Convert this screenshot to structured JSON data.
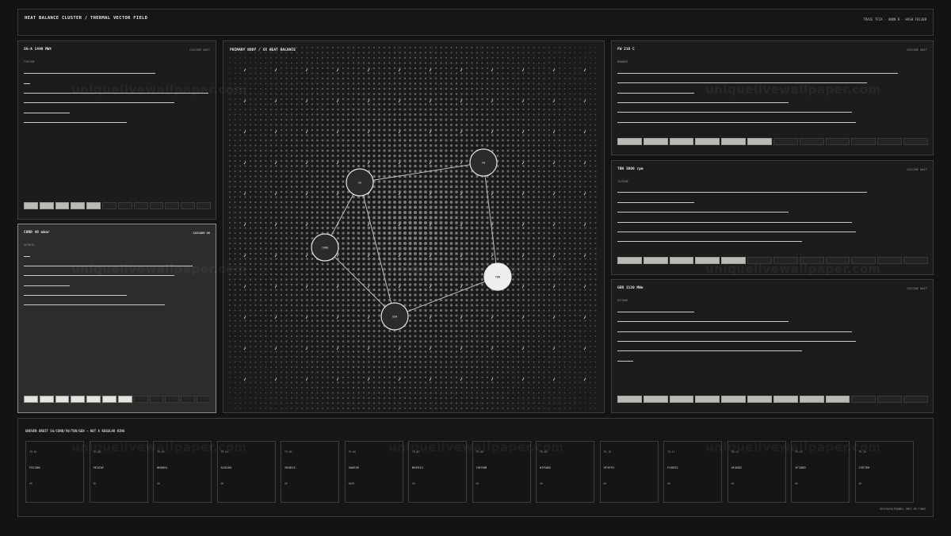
{
  "header": {
    "title": "HEAT BALANCE CLUSTER / THERMAL VECTOR FIELD",
    "meta": "TRACE 7F2A · ANON B · HASH F8130B"
  },
  "panels": {
    "sg": {
      "title": "SG-A 1440 MWt",
      "state": "CASCADE WAIT",
      "sub": "F3913D8",
      "level": 0.42
    },
    "cond": {
      "title": "COND 48 mbar",
      "state": "CASCADE OK",
      "sub": "0A78C2E",
      "level": 0.62
    },
    "fw": {
      "title": "FW 218 C",
      "state": "CASCADE WAIT",
      "sub": "B0A0DE2",
      "level": 0.5
    },
    "tbn": {
      "title": "TBN 3000 rpm",
      "state": "CASCADE WAIT",
      "sub": "7A7D39B",
      "level": 0.42
    },
    "gen": {
      "title": "GEN 1120 MWe",
      "state": "CASCADE WAIT",
      "sub": "E2C2D6E",
      "level": 0.75
    }
  },
  "center": {
    "title": "PRIMARY BODY / XX HEAT BALANCE",
    "nodes": [
      {
        "id": "sg",
        "label": "SG"
      },
      {
        "id": "fw",
        "label": "FW"
      },
      {
        "id": "cond",
        "label": "COND"
      },
      {
        "id": "tbn",
        "label": "TBN"
      },
      {
        "id": "gen",
        "label": "GEN"
      }
    ]
  },
  "orbit": {
    "title": "UNEVEN ORBIT SG/COND/FW/TBN/GEN → NOT A REGULAR RING",
    "footer": "HEXCHAIN/FRONDE/ UNIT XB FIBBS",
    "cards": [
      {
        "id": "TR-01",
        "hex": "F01308",
        "status": "OK"
      },
      {
        "id": "TR-02",
        "hex": "9E1EAF",
        "status": "OK"
      },
      {
        "id": "TR-03",
        "hex": "0B6851",
        "status": "OK"
      },
      {
        "id": "TR-04",
        "hex": "AC0284",
        "status": "OK"
      },
      {
        "id": "TR-05",
        "hex": "2B4D13",
        "status": "OK"
      },
      {
        "id": "TR-06",
        "hex": "3A6E5E",
        "status": "ANOM"
      },
      {
        "id": "TR-07",
        "hex": "B5E913",
        "status": "OK"
      },
      {
        "id": "TR-08",
        "hex": "7AFE8B",
        "status": "OK"
      },
      {
        "id": "TR-09",
        "hex": "63FA80",
        "status": "OK"
      },
      {
        "id": "TR-10",
        "hex": "9F3F91",
        "status": "OK"
      },
      {
        "id": "TR-11",
        "hex": "F28FE2",
        "status": "OK"
      },
      {
        "id": "TR-12",
        "hex": "4F4602",
        "status": "OK"
      },
      {
        "id": "TR-13",
        "hex": "1F1D09",
        "status": "OK"
      },
      {
        "id": "TR-14",
        "hex": "23E789",
        "status": "OK"
      }
    ]
  },
  "watermark": "uniquelivewallpaper.com"
}
